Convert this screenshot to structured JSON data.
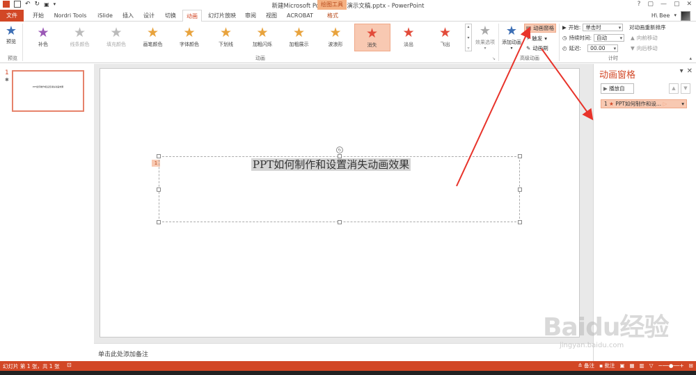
{
  "titlebar": {
    "title": "新建Microsoft PowerPoint 演示文稿.pptx - PowerPoint",
    "context_tab_group": "绘图工具",
    "window_controls": [
      "?",
      "▢",
      "—",
      "▢",
      "✕"
    ]
  },
  "tabs": {
    "file": "文件",
    "items": [
      "开始",
      "Nordri Tools",
      "iSlide",
      "插入",
      "设计",
      "切换",
      "动画",
      "幻灯片放映",
      "审阅",
      "视图",
      "ACROBAT",
      "格式"
    ],
    "active": "动画",
    "user": "H\\ Bee"
  },
  "ribbon": {
    "preview": {
      "label": "预览",
      "group": "预览"
    },
    "animations": [
      {
        "label": "补色",
        "color": "#9b59b6",
        "grey": false
      },
      {
        "label": "线条颜色",
        "color": "#bbbbbb",
        "grey": true
      },
      {
        "label": "填充颜色",
        "color": "#bbbbbb",
        "grey": true
      },
      {
        "label": "画笔颜色",
        "color": "#e8a33d",
        "grey": false
      },
      {
        "label": "字体颜色",
        "color": "#e8a33d",
        "grey": false
      },
      {
        "label": "下划线",
        "color": "#e8a33d",
        "grey": false
      },
      {
        "label": "加粗闪烁",
        "color": "#e8a33d",
        "grey": false
      },
      {
        "label": "加粗展示",
        "color": "#e8a33d",
        "grey": false
      },
      {
        "label": "波浪形",
        "color": "#e8a33d",
        "grey": false
      },
      {
        "label": "消失",
        "color": "#e24b3a",
        "grey": false,
        "selected": true
      },
      {
        "label": "淡出",
        "color": "#e24b3a",
        "grey": false
      },
      {
        "label": "飞出",
        "color": "#e24b3a",
        "grey": false
      }
    ],
    "animation_group": "动画",
    "effect_options": "效果选项",
    "add_animation": "添加动画",
    "advanced": {
      "animation_pane": "动画窗格",
      "trigger": "触发",
      "animation_painter": "动画刷",
      "group": "高级动画"
    },
    "timing": {
      "start_label": "开始:",
      "start_value": "单击时",
      "duration_label": "持续时间:",
      "duration_value": "自动",
      "delay_label": "延迟:",
      "delay_value": "00.00",
      "reorder": "对动画重新排序",
      "move_earlier": "向前移动",
      "move_later": "向后移动",
      "group": "计时"
    }
  },
  "thumbnails": {
    "number": "1",
    "star": "✱",
    "text": "PPT如何制作和设置消失动画效果"
  },
  "slide": {
    "text": "PPT如何制作和设置消失动画效果",
    "anim_tag": "1"
  },
  "notes": {
    "placeholder": "单击此处添加备注"
  },
  "animation_pane": {
    "title": "动画窗格",
    "play": "播放自",
    "entry_index": "1",
    "entry_text": "PPT如何制作和设..."
  },
  "statusbar": {
    "slide_info": "幻灯片 第 1 张，共 1 张",
    "notes": "备注",
    "comments": "批注"
  },
  "watermark": {
    "brand": "Baidu经验",
    "url": "jingyan.baidu.com"
  },
  "colors": {
    "accent": "#d24726",
    "selected_bg": "#f8c9b2",
    "arrow": "#e8332a"
  }
}
